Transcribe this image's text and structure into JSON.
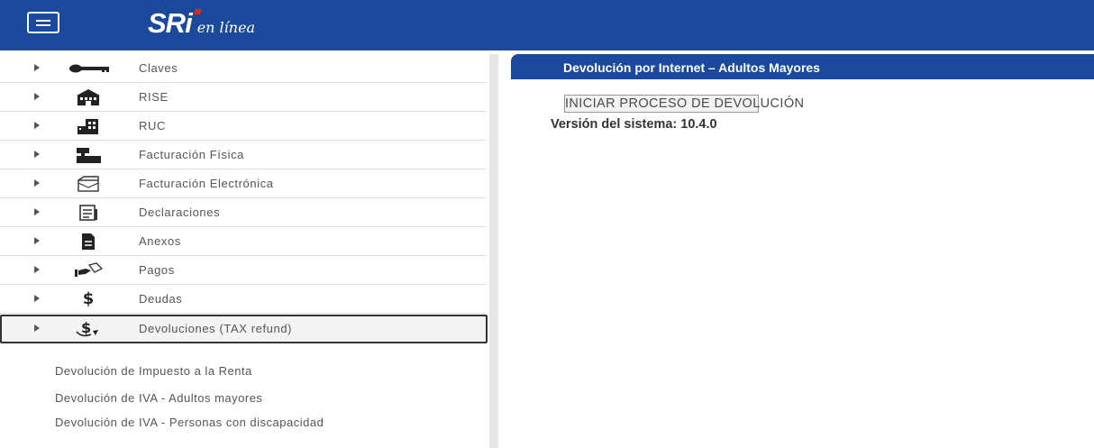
{
  "header": {
    "menu_icon": "hamburger-menu-icon",
    "logo_main": "SRi",
    "logo_sub": "en línea",
    "colors": {
      "bar": "#1b4a9c",
      "logo_dot": "#e2231a"
    }
  },
  "sidebar": {
    "items": [
      {
        "label": "Claves",
        "icon": "key-icon"
      },
      {
        "label": "RISE",
        "icon": "building-icon"
      },
      {
        "label": "RUC",
        "icon": "office-building-icon"
      },
      {
        "label": "Facturación Física",
        "icon": "cash-register-icon"
      },
      {
        "label": "Facturación Electrónica",
        "icon": "envelope-icon"
      },
      {
        "label": "Declaraciones",
        "icon": "document-list-icon"
      },
      {
        "label": "Anexos",
        "icon": "file-icon"
      },
      {
        "label": "Pagos",
        "icon": "hand-payment-icon"
      },
      {
        "label": "Deudas",
        "icon": "dollar-icon"
      },
      {
        "label": "Devoluciones (TAX refund)",
        "icon": "dollar-refund-icon",
        "active": true
      }
    ],
    "sub_items": [
      "Devolución de Impuesto a la Renta",
      "Devolución de IVA - Adultos mayores",
      "Devolución de IVA - Personas con discapacidad"
    ]
  },
  "main": {
    "panel_title": "Devolución por Internet – Adultos Mayores",
    "start_button": "INICIAR PROCESO DE DEVOLUCIÓN",
    "version": "Versión del sistema: 10.4.0"
  }
}
